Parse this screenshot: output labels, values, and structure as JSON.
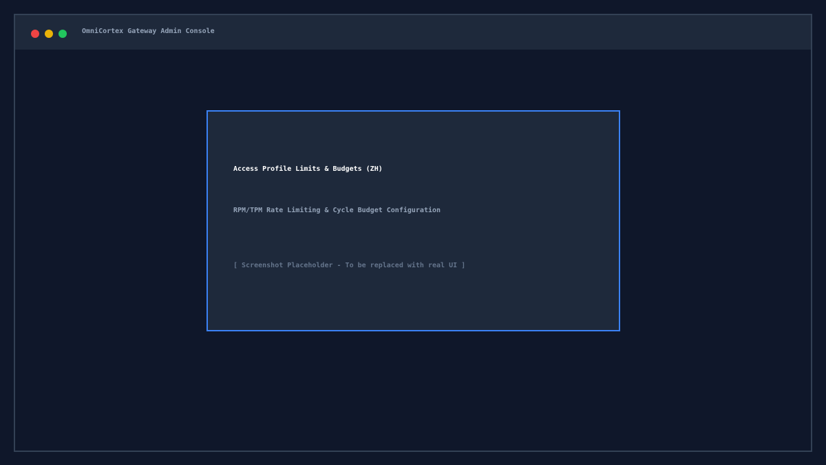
{
  "window": {
    "title": "OmniCortex Gateway Admin Console",
    "controls": {
      "close_color": "#ef4444",
      "minimize_color": "#eab308",
      "maximize_color": "#22c55e"
    }
  },
  "panel": {
    "heading": "Access Profile Limits & Budgets (ZH)",
    "subheading": "RPM/TPM Rate Limiting & Cycle Budget Configuration",
    "placeholder": "[ Screenshot Placeholder - To be replaced with real UI ]",
    "accent_color": "#3b82f6"
  }
}
